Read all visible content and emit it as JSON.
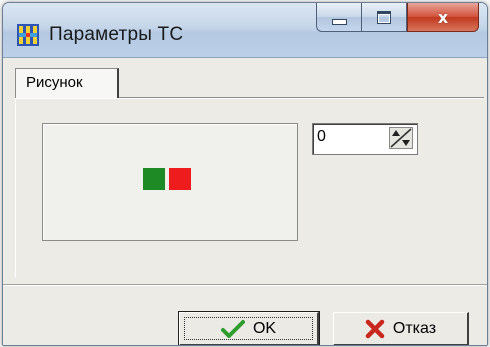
{
  "window": {
    "title": "Параметры ТС",
    "app_icon": "grid-app-icon",
    "controls": {
      "minimize_icon": "minimize-icon",
      "maximize_icon": "maximize-icon",
      "close_icon": "close-icon",
      "close_glyph": "x"
    }
  },
  "tabs": [
    {
      "label": "Рисунок",
      "selected": true
    }
  ],
  "picture": {
    "colors": [
      "#1e8a26",
      "#ee1c1c"
    ]
  },
  "spin": {
    "value": "0"
  },
  "buttons": {
    "ok_label": "OK",
    "ok_icon": "checkmark-icon",
    "cancel_label": "Отказ",
    "cancel_icon": "cross-icon"
  },
  "colors": {
    "green_square": "#1e8a26",
    "red_square": "#ee1c1c",
    "check_green": "#2e9d2e",
    "cross_red": "#c8281e"
  }
}
